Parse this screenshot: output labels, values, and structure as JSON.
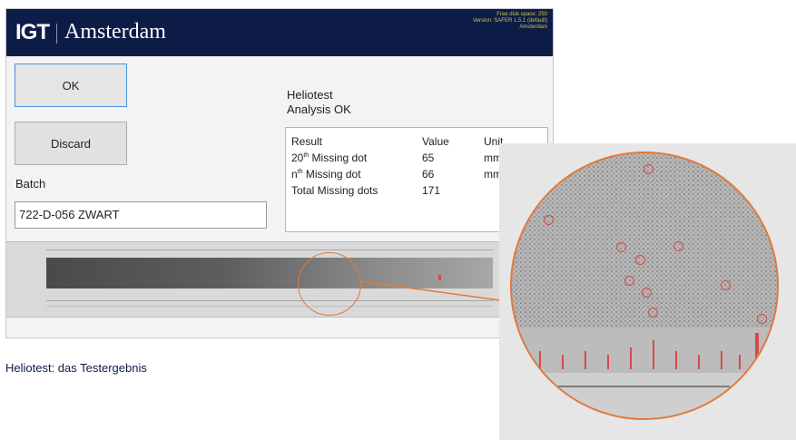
{
  "window": {
    "logo": "IGT",
    "title": "Amsterdam",
    "sys_info": [
      "Free disk space: 250",
      "Version: SAFER 1.5.1 (default)",
      "Amsterdam"
    ]
  },
  "buttons": {
    "ok": "OK",
    "discard": "Discard"
  },
  "batch": {
    "label": "Batch",
    "value": "722-D-056 ZWART"
  },
  "status": {
    "title": "Heliotest",
    "subtitle": "Analysis OK"
  },
  "results": {
    "headers": [
      "Result",
      "Value",
      "Unit"
    ],
    "rows": [
      {
        "label_pre": "20",
        "label_sup": "th",
        "label_post": " Missing dot",
        "value": "65",
        "unit": "mm"
      },
      {
        "label_pre": "n",
        "label_sup": "th",
        "label_post": " Missing dot",
        "value": "66",
        "unit": "mm"
      },
      {
        "label_pre": "Total Missing dots",
        "label_sup": "",
        "label_post": "",
        "value": "171",
        "unit": ""
      }
    ]
  },
  "caption": "Heliotest: das Testergebnis",
  "colors": {
    "title_bar": "#0d1c47",
    "accent": "#e07a3a",
    "marker": "#d64a4a"
  }
}
